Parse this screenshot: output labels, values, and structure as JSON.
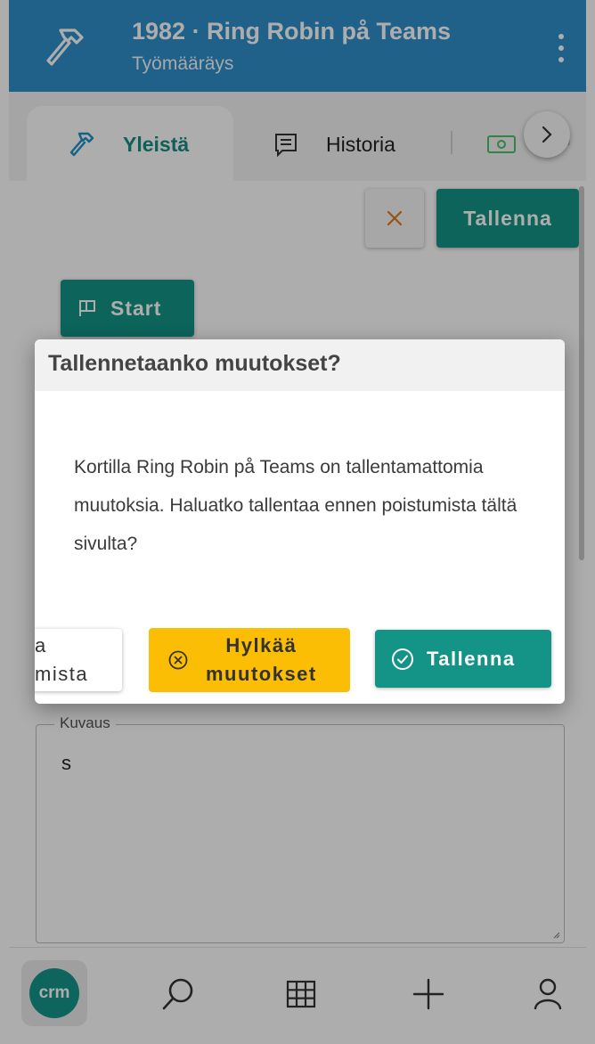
{
  "appbar": {
    "title": "1982 · Ring Robin på Teams",
    "subtitle": "Työmääräys"
  },
  "tabs": [
    {
      "label": "Yleistä",
      "icon": "hammer-icon",
      "active": true
    },
    {
      "label": "Historia",
      "icon": "message-icon",
      "active": false
    },
    {
      "label": "",
      "icon": "money-icon",
      "active": false
    }
  ],
  "toolbar": {
    "save_label": "Tallenna"
  },
  "start_button": {
    "label": "Start"
  },
  "description": {
    "label": "Kuvaus",
    "value": "s"
  },
  "dialog": {
    "title": "Tallennetaanko muutokset?",
    "body": "Kortilla Ring Robin på Teams on tallentamattomia muutoksia. Haluatko tallentaa ennen poistumista tältä sivulta?",
    "partial_button": {
      "line1": "a",
      "line2": "mista"
    },
    "discard_button": {
      "line1": "Hylkää",
      "line2": "muutokset"
    },
    "save_button": {
      "label": "Tallenna"
    }
  },
  "bottom_nav": {
    "logo_text": "crm",
    "items": [
      "search-icon",
      "grid-icon",
      "add-icon",
      "user-icon"
    ]
  },
  "colors": {
    "appbar": "#2f8fca",
    "primary": "#139486",
    "warning": "#fcbd05",
    "accent_orange": "#e07b1a"
  }
}
